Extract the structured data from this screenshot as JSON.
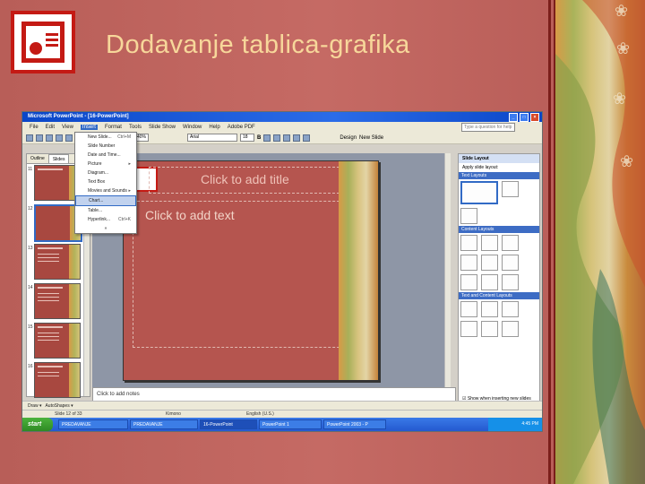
{
  "slide_title": "Dodavanje tablica-grafika",
  "window": {
    "title": "Microsoft PowerPoint - [16-PowerPoint]",
    "help_placeholder": "Type a question for help"
  },
  "menubar": [
    "File",
    "Edit",
    "View",
    "Insert",
    "Format",
    "Tools",
    "Slide Show",
    "Window",
    "Help",
    "Adobe PDF"
  ],
  "menubar_selected": "Insert",
  "toolbar": {
    "font": "Arial",
    "font_size": "18",
    "zoom": "40%",
    "design": "Design",
    "new_slide": "New Slide"
  },
  "left_tabs": [
    "Outline",
    "Slides"
  ],
  "slide_numbers": [
    "11",
    "12",
    "13",
    "14",
    "15",
    "16"
  ],
  "insert_menu": [
    {
      "label": "New Slide...",
      "key": "Ctrl+M"
    },
    {
      "label": "Slide Number",
      "key": ""
    },
    {
      "label": "Date and Time...",
      "key": ""
    },
    {
      "label": "Picture",
      "key": "▸"
    },
    {
      "label": "Diagram...",
      "key": ""
    },
    {
      "label": "Text Box",
      "key": ""
    },
    {
      "label": "Movies and Sounds",
      "key": "▸"
    },
    {
      "label": "Chart...",
      "key": ""
    },
    {
      "label": "Table...",
      "key": ""
    },
    {
      "label": "Hyperlink...",
      "key": "Ctrl+K"
    },
    {
      "label": "»",
      "key": ""
    }
  ],
  "insert_menu_highlight": 7,
  "slide": {
    "title_placeholder": "Click to add title",
    "text_placeholder": "Click to add text"
  },
  "notes_placeholder": "Click to add notes",
  "taskpane": {
    "title": "Slide Layout",
    "apply_label": "Apply slide layout:",
    "sections": [
      "Text Layouts",
      "Content Layouts",
      "Text and Content Layouts"
    ],
    "show_label": "Show when inserting new slides"
  },
  "draw_bar": {
    "draw": "Draw",
    "autoshapes": "AutoShapes"
  },
  "status": {
    "slide": "Slide 12 of 33",
    "design": "Kimono",
    "language": "English (U.S.)"
  },
  "taskbar": {
    "start": "start",
    "tasks": [
      "PREDAVANJE",
      "PREDAVANJE",
      "16-PowerPoint",
      "PowerPoint 1",
      "PowerPoint 2003 - P"
    ],
    "active_task": 2,
    "clock": "4:45 PM"
  },
  "colors": {
    "background": "#c16560",
    "title_text": "#f7d79a",
    "logo_red": "#c41a14"
  }
}
